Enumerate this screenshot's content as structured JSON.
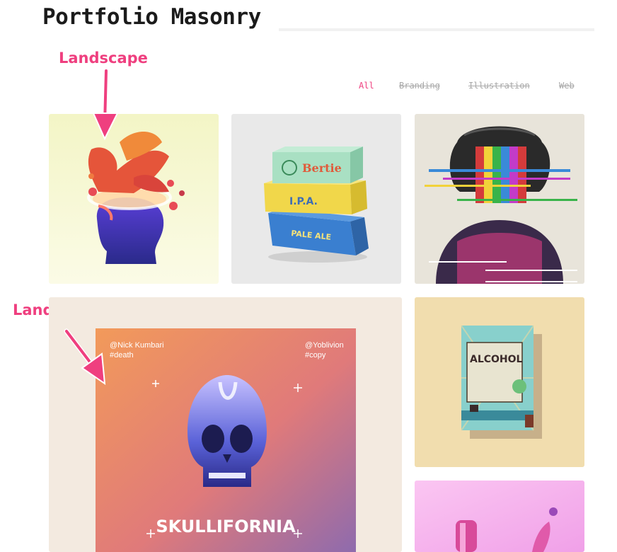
{
  "header": {
    "title": "Portfolio Masonry"
  },
  "annotations": {
    "landscape": "Landscape",
    "landscape_big": "Landscape Big"
  },
  "filters": [
    {
      "label": "All",
      "active": true
    },
    {
      "label": "Branding",
      "active": false
    },
    {
      "label": "Illustration",
      "active": false
    },
    {
      "label": "Web",
      "active": false
    }
  ],
  "poster": {
    "handle_left": "@Nick Kumbari",
    "tag_left": "#death",
    "handle_right": "@Yoblivion",
    "tag_right": "#copy",
    "title": "SKULLIFORNIA"
  },
  "boxes": {
    "top": "Bertie",
    "middle": "I.P.A.",
    "bottom": "PALE ALE"
  },
  "book": {
    "title": "ALCOHOL"
  },
  "colors": {
    "accent": "#ef3f7f",
    "filter_inactive": "#a8a8a8",
    "title": "#1b1b1b"
  }
}
